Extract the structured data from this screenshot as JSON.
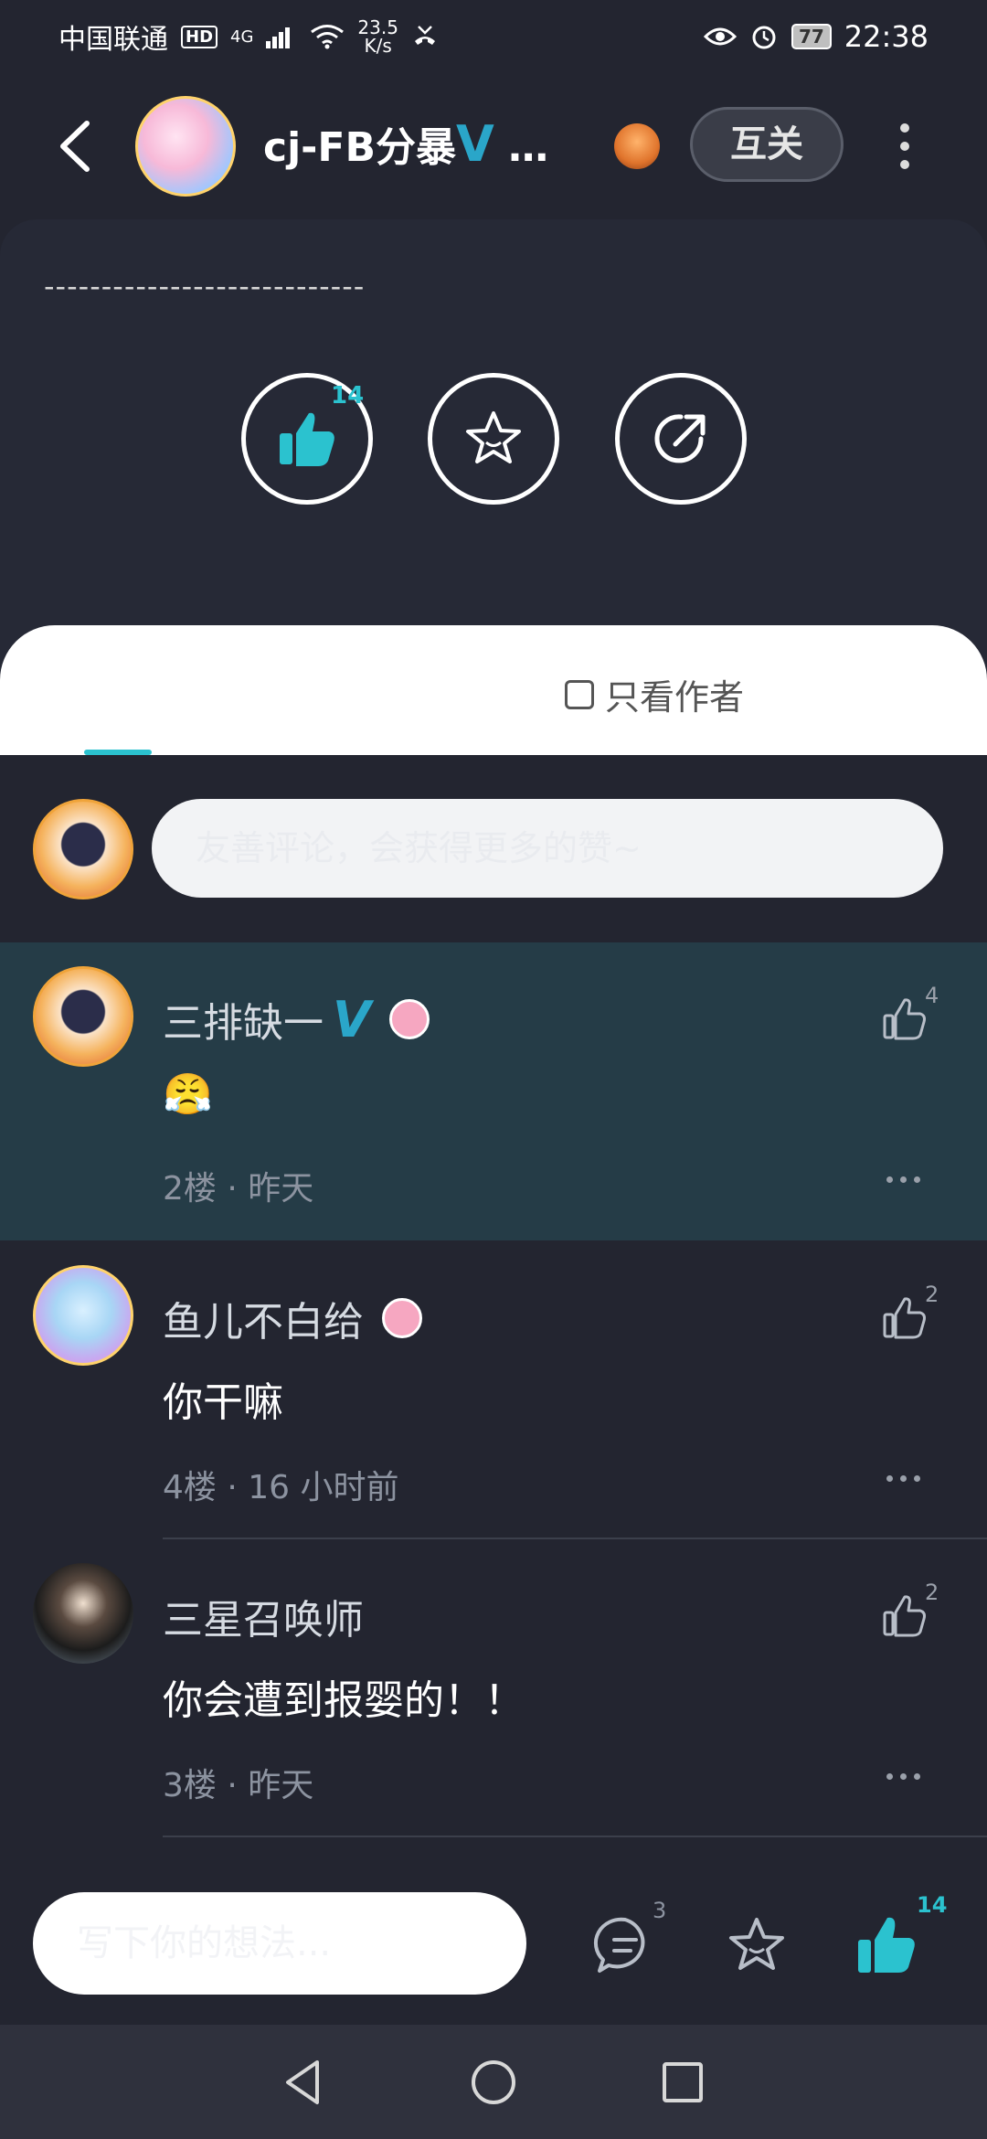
{
  "status_bar": {
    "carrier": "中国联通",
    "hd": "HD",
    "signal": "4G",
    "net_speed_value": "23.5",
    "net_speed_unit": "K/s",
    "battery": "77",
    "time": "22:38"
  },
  "header": {
    "author_name": "cj-FB分暴",
    "author_verified": "V",
    "author_name_ellipsis": " …",
    "follow_label": "互关"
  },
  "post": {
    "divider_text": "----------------------------",
    "like_count": "14"
  },
  "tabs": {
    "author_only_label": "只看作者"
  },
  "comment_input": {
    "placeholder": "友善评论，会获得更多的赞~"
  },
  "comments": [
    {
      "name": "三排缺一",
      "verified": "V",
      "text": "😤",
      "meta": "2楼 · 昨天",
      "likes": "4"
    },
    {
      "name": "鱼儿不白给",
      "verified": "",
      "text": "你干嘛",
      "meta": "4楼 · 16 小时前",
      "likes": "2"
    },
    {
      "name": "三星召唤师",
      "verified": "",
      "text": "你会遭到报婴的！！",
      "meta": "3楼 · 昨天",
      "likes": "2"
    }
  ],
  "bottom_bar": {
    "placeholder": "写下你的想法...",
    "comment_count": "3",
    "like_count": "14"
  },
  "colors": {
    "accent": "#2bc2cf",
    "background": "#232530",
    "highlight_row": "#253c47",
    "verified": "#2aa6c9"
  }
}
